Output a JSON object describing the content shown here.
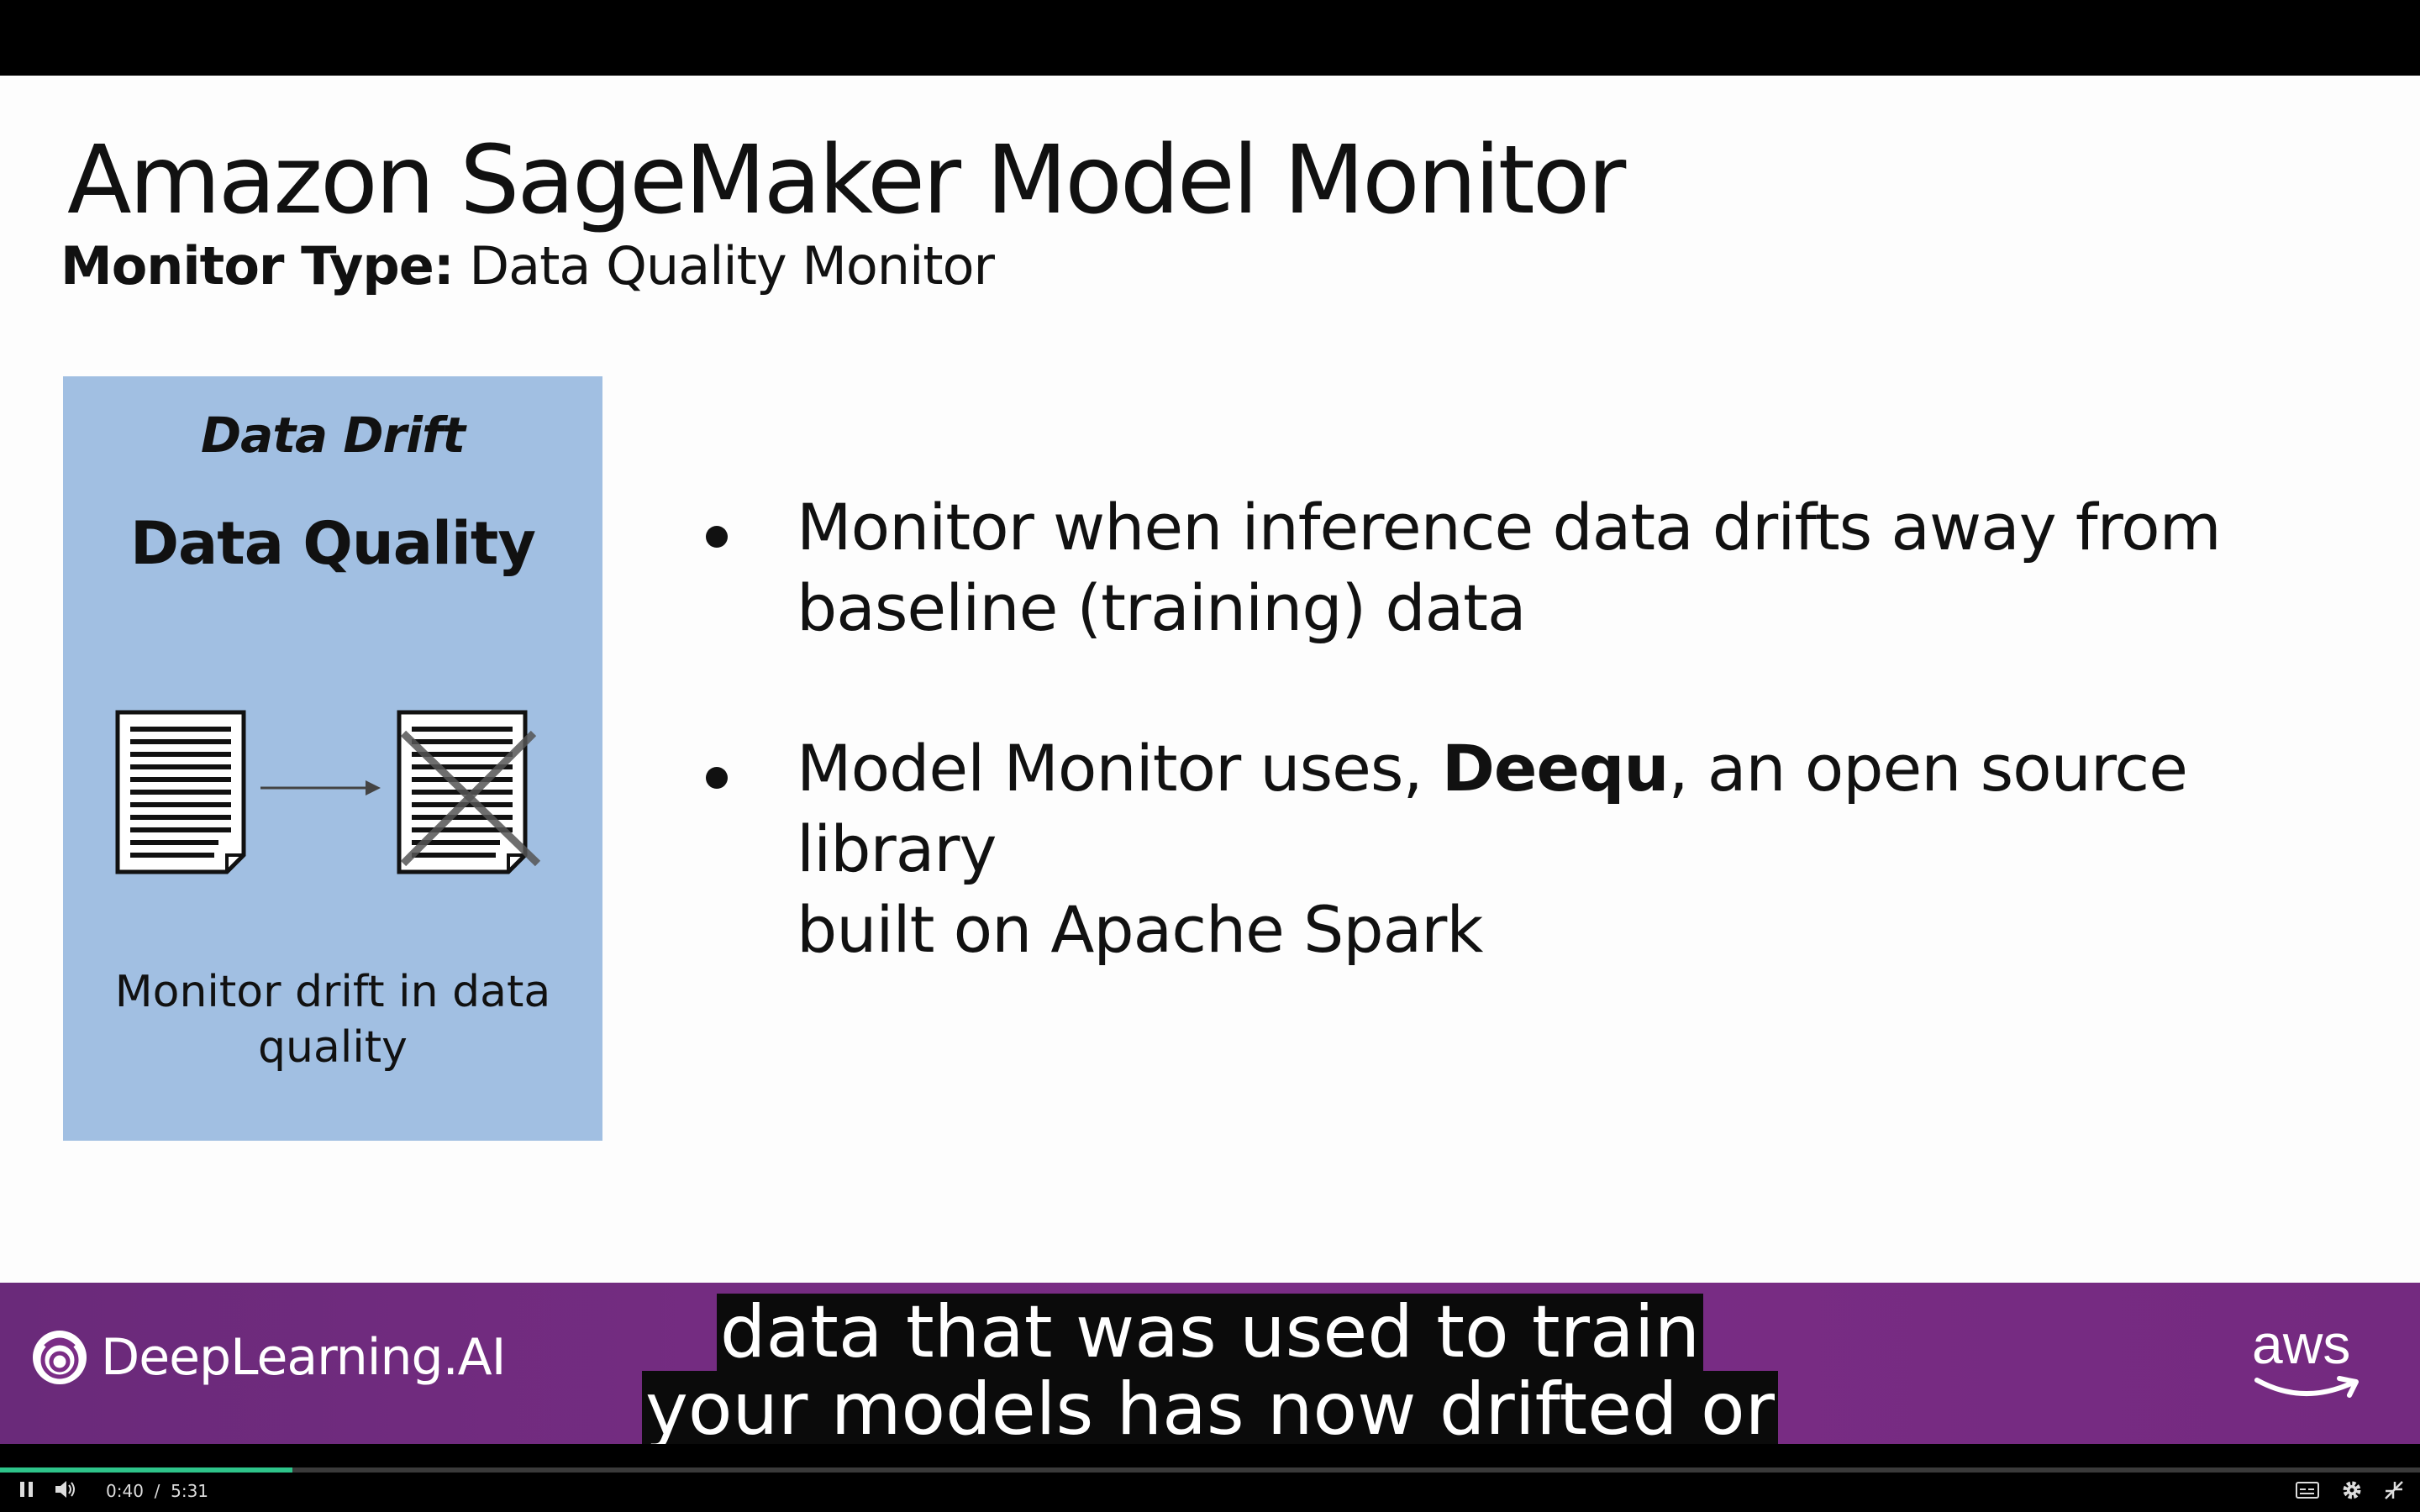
{
  "slide": {
    "title": "Amazon SageMaker Model Monitor",
    "subtitle_label": "Monitor Type:",
    "subtitle_value": " Data Quality Monitor",
    "card": {
      "heading_italic": "Data Drift",
      "heading": "Data Quality",
      "text_line1": "Monitor drift in data",
      "text_line2": "quality"
    },
    "bullets": [
      {
        "line1": "Monitor when inference data drifts away from",
        "line2": "baseline (training) data"
      },
      {
        "line1_prefix": "Model Monitor uses, ",
        "line1_bold": "Deequ",
        "line1_suffix": ", an open source library",
        "line2": "built on Apache Spark"
      }
    ]
  },
  "banner": {
    "brand": "DeepLearning.AI",
    "aws_logo": "aws"
  },
  "captions": {
    "line1": "data that was used to train",
    "line2": "your models has now drifted or"
  },
  "player": {
    "current_time": "0:40",
    "separator": "/",
    "duration": "5:31",
    "progress_fraction": 0.121,
    "icons": [
      "pause-icon",
      "volume-icon",
      "captions-icon",
      "settings-icon",
      "exit-fullscreen-icon"
    ],
    "accent_color": "#2ec48a"
  }
}
